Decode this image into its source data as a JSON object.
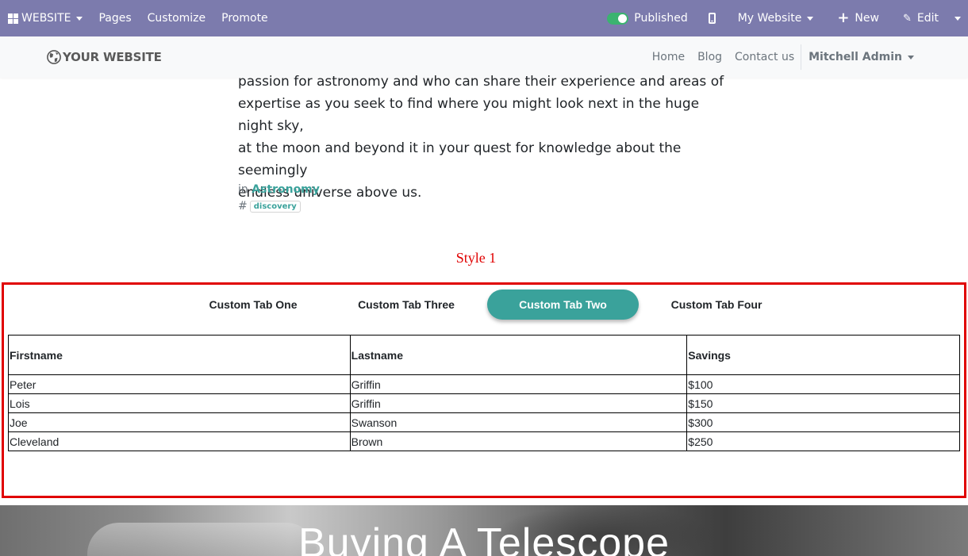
{
  "admin_bar": {
    "brand": "WEBSITE",
    "menu": [
      "Pages",
      "Customize",
      "Promote"
    ],
    "published": "Published",
    "site_switcher": "My Website",
    "new_label": "New",
    "edit_label": "Edit",
    "accent_color": "#7c7bad"
  },
  "site_header": {
    "logo": "YOUR WEBSITE",
    "nav": [
      "Home",
      "Blog",
      "Contact us"
    ],
    "user": "Mitchell Admin"
  },
  "article": {
    "lines": [
      "passion for astronomy and who can share their experience and areas of",
      "expertise as you seek to find where you might look next in the huge night sky,",
      "at the moon and beyond it in your quest for knowledge about the seemingly",
      "endless universe above us."
    ],
    "category_prefix": "in",
    "category": "Astronomy",
    "tag_prefix": "#",
    "tag": "discovery"
  },
  "style_title": "Style 1",
  "tabs": {
    "items": [
      "Custom Tab One",
      "Custom Tab Three",
      "Custom Tab Two",
      "Custom Tab Four"
    ],
    "active": "Custom Tab Two",
    "active_color": "#3aa29b"
  },
  "table": {
    "headers": [
      "Firstname",
      "Lastname",
      "Savings"
    ],
    "rows": [
      [
        "Peter",
        "Griffin",
        "$100"
      ],
      [
        "Lois",
        "Griffin",
        "$150"
      ],
      [
        "Joe",
        "Swanson",
        "$300"
      ],
      [
        "Cleveland",
        "Brown",
        "$250"
      ]
    ]
  },
  "hero": {
    "title": "Buying A Telescope"
  }
}
